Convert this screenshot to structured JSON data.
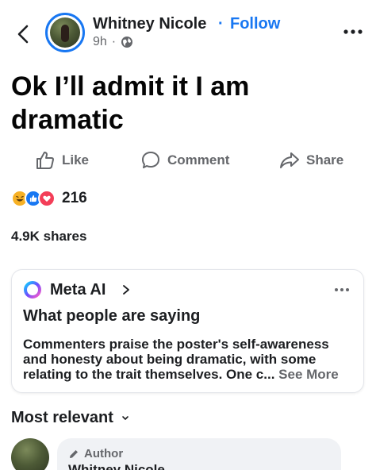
{
  "header": {
    "author_name": "Whitney Nicole",
    "separator": "·",
    "follow_label": "Follow",
    "time": "9h",
    "time_dot": "·",
    "privacy_icon": "globe-icon"
  },
  "post": {
    "text": "Ok I’ll admit it I am dramatic"
  },
  "actions": {
    "like_label": "Like",
    "comment_label": "Comment",
    "share_label": "Share"
  },
  "reactions": {
    "types": [
      "haha",
      "like",
      "love"
    ],
    "count": "216"
  },
  "shares": {
    "label": "4.9K shares"
  },
  "meta_ai_card": {
    "brand": "Meta AI",
    "heading": "What people are saying",
    "summary": "Commenters praise the poster's self-awareness and honesty about being dramatic, with some relating to the trait themselves. One c...",
    "see_more": "See More"
  },
  "comments": {
    "sort_label": "Most relevant",
    "first": {
      "badge": "Author",
      "name": "Whitney Nicole"
    }
  },
  "colors": {
    "accent": "#1877f2",
    "muted": "#65676b",
    "text": "#1c1e21"
  }
}
